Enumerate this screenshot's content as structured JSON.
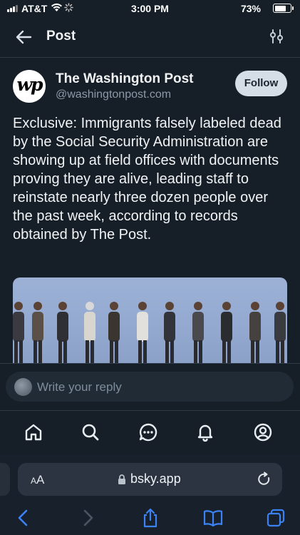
{
  "status_bar": {
    "carrier": "AT&T",
    "time": "3:00 PM",
    "battery": "73%",
    "battery_level": 0.73
  },
  "header": {
    "title": "Post"
  },
  "post": {
    "author_name": "The Washington Post",
    "author_handle": "@washingtonpost.com",
    "avatar_text": "wp",
    "follow_label": "Follow",
    "text": "Exclusive: Immigrants falsely labeled dead by the Social Security Administration are showing up at field offices with documents proving they are alive, leading staff to reinstate nearly three dozen people over the past week, according to records obtained by The Post."
  },
  "reply": {
    "placeholder": "Write your reply"
  },
  "tabbar": {
    "items": [
      "home-icon",
      "search-icon",
      "chat-icon",
      "bell-icon",
      "profile-icon"
    ]
  },
  "browser": {
    "aa_label": "AA",
    "url": "bsky.app"
  },
  "colors": {
    "background": "#161e27",
    "follow_button": "#d5dde6",
    "accent": "#3b82f6"
  }
}
